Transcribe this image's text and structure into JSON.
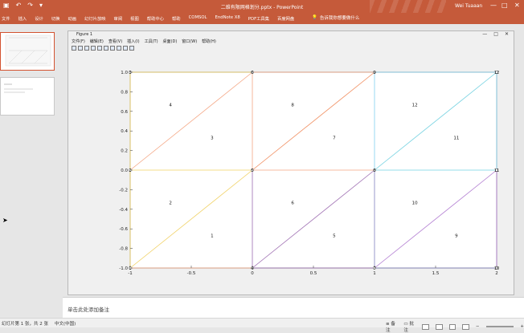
{
  "window": {
    "document_title": "二维有限网格划分.pptx - PowerPoint",
    "user": "Wei Tuaaan",
    "minimize": "—",
    "maximize": "□",
    "close": "✕"
  },
  "ribbon": {
    "tabs": [
      "文件",
      "插入",
      "设计",
      "切换",
      "动画",
      "幻灯片放映",
      "审阅",
      "视图",
      "帮助中心",
      "帮助",
      "COMSOL",
      "EndNote X8",
      "PDF工具集",
      "百度网盘"
    ],
    "tell_me": "告诉我你想要做什么"
  },
  "figure": {
    "title": "Figure 1",
    "menu": [
      "文件(F)",
      "编辑(E)",
      "查看(V)",
      "插入(I)",
      "工具(T)",
      "桌面(D)",
      "窗口(W)",
      "帮助(H)"
    ],
    "win_minimize": "—",
    "win_maximize": "□",
    "win_close": "✕"
  },
  "chart_data": {
    "type": "mesh",
    "xlim": [
      -1,
      2
    ],
    "ylim": [
      -1,
      1
    ],
    "x_ticks": [
      -1,
      -0.5,
      0,
      0.5,
      1,
      1.5,
      2
    ],
    "x_tick_labels": [
      "-1",
      "-0.5",
      "0",
      "0.5",
      "1",
      "1.5",
      "2"
    ],
    "y_ticks": [
      -1,
      -0.8,
      -0.6,
      -0.4,
      -0.2,
      0,
      0.2,
      0.4,
      0.6,
      0.8,
      1
    ],
    "y_tick_labels": [
      "-1.0",
      "-0.8",
      "-0.6",
      "-0.4",
      "-0.2",
      "0.0",
      "0.2",
      "0.4",
      "0.6",
      "0.8",
      "1.0"
    ],
    "grid": false,
    "nodes": [
      {
        "id": "1",
        "x": -1,
        "y": -1
      },
      {
        "id": "2",
        "x": -1,
        "y": 0
      },
      {
        "id": "3",
        "x": -1,
        "y": 1
      },
      {
        "id": "4",
        "x": 0,
        "y": -1
      },
      {
        "id": "5",
        "x": 0,
        "y": 0
      },
      {
        "id": "6",
        "x": 0,
        "y": 1
      },
      {
        "id": "7",
        "x": 1,
        "y": -1
      },
      {
        "id": "8",
        "x": 1,
        "y": 0
      },
      {
        "id": "9",
        "x": 1,
        "y": 1
      },
      {
        "id": "10",
        "x": 2,
        "y": -1
      },
      {
        "id": "11",
        "x": 2,
        "y": 0
      },
      {
        "id": "12",
        "x": 2,
        "y": 1
      }
    ],
    "elements": [
      {
        "label": "1",
        "x": -0.33,
        "y": -0.67,
        "color": "#f4a582"
      },
      {
        "label": "2",
        "x": -0.67,
        "y": -0.33,
        "color": "#f0d060"
      },
      {
        "label": "3",
        "x": -0.33,
        "y": 0.33,
        "color": "#f0d060"
      },
      {
        "label": "4",
        "x": -0.67,
        "y": 0.67,
        "color": "#f4a582"
      },
      {
        "label": "5",
        "x": 0.67,
        "y": -0.67,
        "color": "#8080c0"
      },
      {
        "label": "6",
        "x": 0.33,
        "y": -0.33,
        "color": "#9c6bb0"
      },
      {
        "label": "7",
        "x": 0.67,
        "y": 0.33,
        "color": "#f08a5a"
      },
      {
        "label": "8",
        "x": 0.33,
        "y": 0.67,
        "color": "#f4a582"
      },
      {
        "label": "9",
        "x": 1.67,
        "y": -0.67,
        "color": "#b07ad0"
      },
      {
        "label": "10",
        "x": 1.33,
        "y": -0.33,
        "color": "#d070b0"
      },
      {
        "label": "11",
        "x": 1.67,
        "y": 0.33,
        "color": "#70d0e0"
      },
      {
        "label": "12",
        "x": 1.33,
        "y": 0.67,
        "color": "#80d0f0"
      }
    ],
    "edges": [
      {
        "x1": -1,
        "y1": -1,
        "x2": 0,
        "y2": -1,
        "color": "#f4a582"
      },
      {
        "x1": 0,
        "y1": -1,
        "x2": 1,
        "y2": -1,
        "color": "#9c6bb0"
      },
      {
        "x1": 1,
        "y1": -1,
        "x2": 2,
        "y2": -1,
        "color": "#8080c0"
      },
      {
        "x1": -1,
        "y1": 0,
        "x2": 0,
        "y2": 0,
        "color": "#f0d060"
      },
      {
        "x1": 0,
        "y1": 0,
        "x2": 1,
        "y2": 0,
        "color": "#f4a582"
      },
      {
        "x1": 1,
        "y1": 0,
        "x2": 2,
        "y2": 0,
        "color": "#70d0e0"
      },
      {
        "x1": -1,
        "y1": 1,
        "x2": 0,
        "y2": 1,
        "color": "#f0d060"
      },
      {
        "x1": 0,
        "y1": 1,
        "x2": 1,
        "y2": 1,
        "color": "#f4a582"
      },
      {
        "x1": 1,
        "y1": 1,
        "x2": 2,
        "y2": 1,
        "color": "#80d0f0"
      },
      {
        "x1": -1,
        "y1": -1,
        "x2": -1,
        "y2": 0,
        "color": "#f0d060"
      },
      {
        "x1": -1,
        "y1": 0,
        "x2": -1,
        "y2": 1,
        "color": "#f0d060"
      },
      {
        "x1": 0,
        "y1": -1,
        "x2": 0,
        "y2": 0,
        "color": "#9c6bb0"
      },
      {
        "x1": 0,
        "y1": 0,
        "x2": 0,
        "y2": 1,
        "color": "#f4a582"
      },
      {
        "x1": 1,
        "y1": -1,
        "x2": 1,
        "y2": 0,
        "color": "#8080c0"
      },
      {
        "x1": 1,
        "y1": 0,
        "x2": 1,
        "y2": 1,
        "color": "#80d0f0"
      },
      {
        "x1": 2,
        "y1": -1,
        "x2": 2,
        "y2": 0,
        "color": "#b07ad0"
      },
      {
        "x1": 2,
        "y1": 0,
        "x2": 2,
        "y2": 1,
        "color": "#80d0f0"
      },
      {
        "x1": -1,
        "y1": -1,
        "x2": 0,
        "y2": 0,
        "color": "#f0d060"
      },
      {
        "x1": -1,
        "y1": 0,
        "x2": 0,
        "y2": 1,
        "color": "#f4a582"
      },
      {
        "x1": 0,
        "y1": -1,
        "x2": 1,
        "y2": 0,
        "color": "#9c6bb0"
      },
      {
        "x1": 0,
        "y1": 0,
        "x2": 1,
        "y2": 1,
        "color": "#f08a5a"
      },
      {
        "x1": 1,
        "y1": -1,
        "x2": 2,
        "y2": 0,
        "color": "#b07ad0"
      },
      {
        "x1": 1,
        "y1": 0,
        "x2": 2,
        "y2": 1,
        "color": "#70d0e0"
      }
    ]
  },
  "notes": {
    "placeholder": "单击此处添加备注"
  },
  "status": {
    "slide_info": "幻灯片第 1 张，共 2 张",
    "language": "中文(中国)",
    "notes_button": "备注",
    "comments_button": "批注"
  }
}
